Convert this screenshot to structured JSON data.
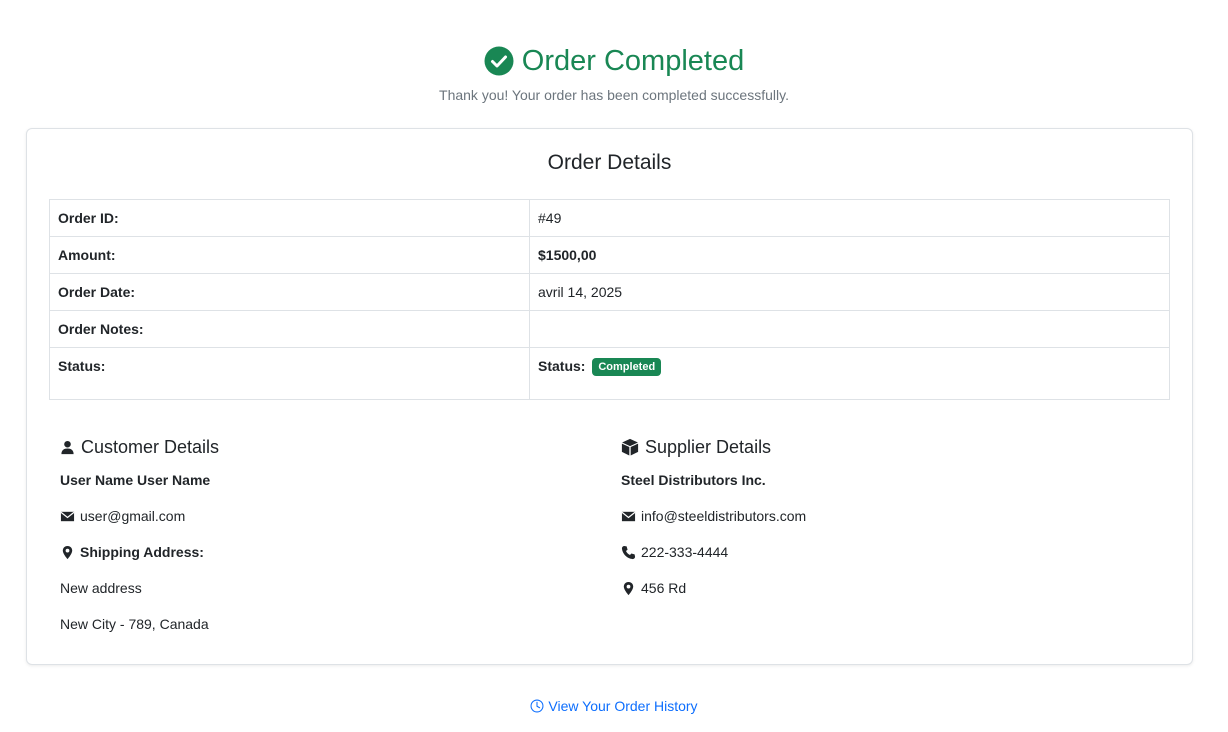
{
  "header": {
    "title": "Order Completed",
    "subtitle": "Thank you! Your order has been completed successfully."
  },
  "order": {
    "section_title": "Order Details",
    "rows": [
      {
        "label": "Order ID:",
        "value": "#49"
      },
      {
        "label": "Amount:",
        "value": "$1500,00"
      },
      {
        "label": "Order Date:",
        "value": "avril 14, 2025"
      },
      {
        "label": "Order Notes:",
        "value": ""
      }
    ],
    "status_label": "Status:",
    "status_inline_label": "Status:",
    "status_badge": "Completed"
  },
  "customer": {
    "heading": "Customer Details",
    "name": "User Name User Name",
    "email": "user@gmail.com",
    "shipping_label": "Shipping Address:",
    "address_line1": "New address",
    "address_line2": "New City - 789, Canada"
  },
  "supplier": {
    "heading": "Supplier Details",
    "name": "Steel Distributors Inc.",
    "email": "info@steeldistributors.com",
    "phone": "222-333-4444",
    "address": "456 Rd"
  },
  "footer": {
    "history_link": "View Your Order History"
  },
  "colors": {
    "success": "#198754",
    "link": "#0d6efd",
    "muted": "#6c757d"
  }
}
